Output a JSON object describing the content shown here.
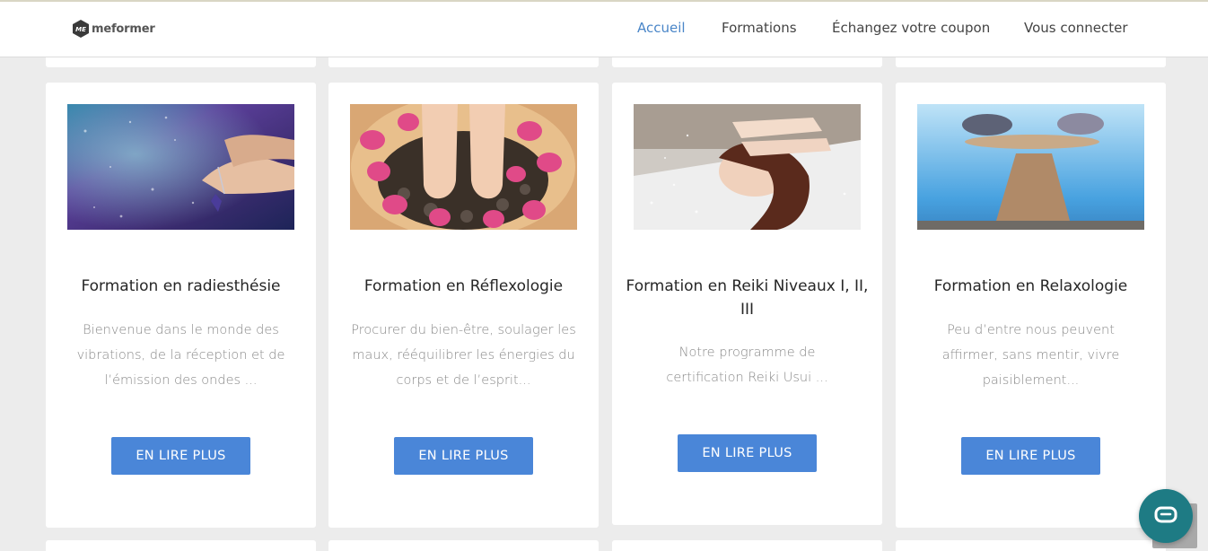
{
  "brand": {
    "logo_text": "meformer",
    "logo_mark_text": "ME"
  },
  "nav": {
    "items": [
      {
        "label": "Accueil",
        "active": true
      },
      {
        "label": "Formations",
        "active": false
      },
      {
        "label": "Échangez votre coupon",
        "active": false
      },
      {
        "label": "Vous connecter",
        "active": false
      }
    ]
  },
  "cards": [
    {
      "image": "crystal-pendulum-hands-photo",
      "title": "Formation en radiesthésie",
      "description": "Bienvenue dans le monde des vibrations, de la réception et de l’émission des ondes ...",
      "button": "EN LIRE PLUS"
    },
    {
      "image": "feet-rose-petals-bowl-photo",
      "title": "Formation en Réflexologie",
      "description": "Procurer du bien-être, soulager les maux, rééquilibrer les énergies du corps et de l’esprit...",
      "button": "EN LIRE PLUS"
    },
    {
      "image": "reiki-healing-woman-photo",
      "title": "Formation en Reiki Niveaux I, II, III",
      "description": "Notre programme de certification Reiki Usui  ...",
      "button": "EN LIRE PLUS"
    },
    {
      "image": "balanced-stones-photo",
      "title": "Formation en Relaxologie",
      "description": "Peu d’entre nous peuvent affirmer, sans mentir, vivre paisiblement...",
      "button": "EN LIRE PLUS"
    }
  ],
  "chat": {
    "icon": "chat-bubble-icon"
  },
  "colors": {
    "accent": "#4a86d8",
    "nav_active": "#4a86c8",
    "chat": "#1e7b84",
    "background": "#ececec"
  }
}
